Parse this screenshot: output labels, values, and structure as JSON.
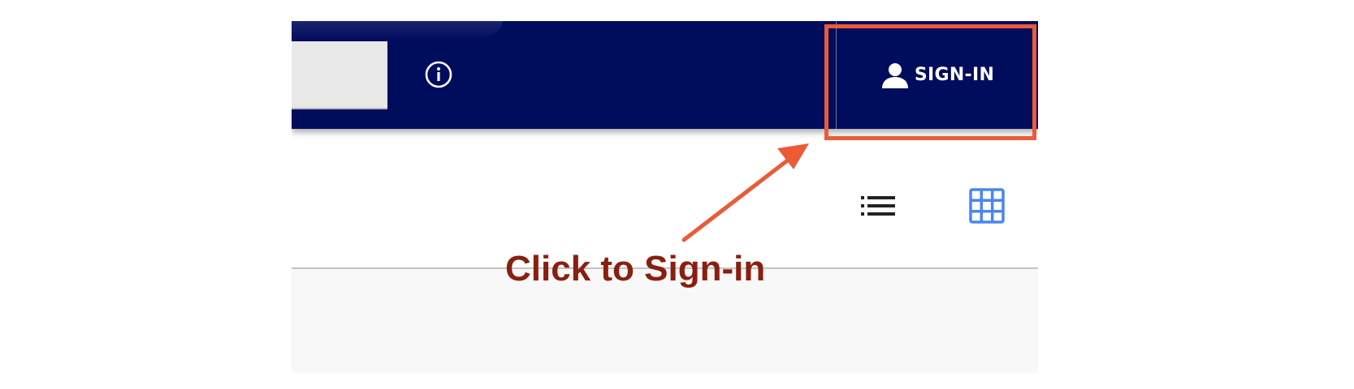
{
  "header": {
    "search_placeholder": "",
    "info_icon": "info-circle-icon",
    "signin_label": "SIGN-IN",
    "user_icon": "user-icon",
    "background": "#000c5c"
  },
  "toolbar": {
    "list_view_icon": "list-view-icon",
    "grid_view_icon": "grid-view-icon",
    "grid_view_active_color": "#4a86f0"
  },
  "annotation": {
    "text": "Click to Sign-in",
    "color": "#8a1f0f",
    "highlight_color": "#ec5a38"
  }
}
